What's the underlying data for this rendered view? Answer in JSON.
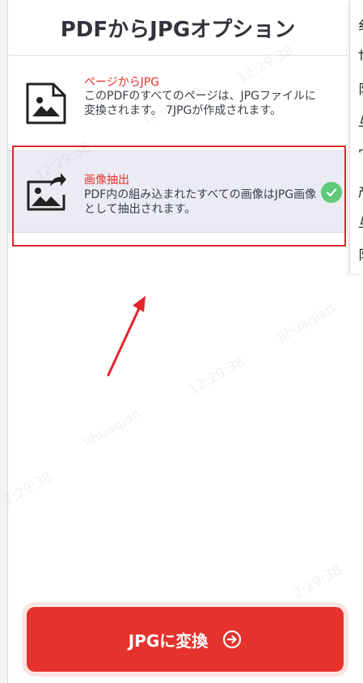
{
  "header": {
    "title": "PDFからJPGオプション"
  },
  "options": [
    {
      "name": "ページからJPG",
      "description": "このPDFのすべてのページは、JPGファイルに変換されます。 7JPGが作成されます。",
      "selected": false
    },
    {
      "name": "画像抽出",
      "description": "PDF内の組み込まれたすべての画像はJPG画像として抽出されます。",
      "selected": true
    }
  ],
  "action": {
    "convert_label": "JPGに変換"
  },
  "watermark": {
    "user": "lihuaqian",
    "time": "12:29:38",
    "time_short": "2:29:38"
  },
  "colors": {
    "accent": "#e5322d",
    "check": "#5fc97b",
    "highlight": "#e3242b"
  }
}
